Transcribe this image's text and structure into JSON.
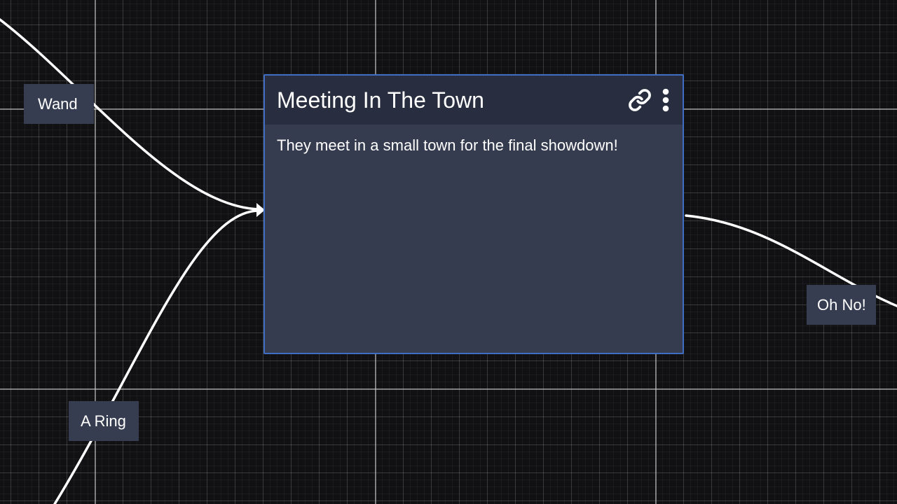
{
  "node": {
    "title": "Meeting In The Town",
    "body": "They meet in a small town for the final showdown!",
    "icons": [
      "link-icon",
      "more-vertical-icon"
    ]
  },
  "edge_labels": {
    "wand": "Wand",
    "ring": "A Ring",
    "oh_no": "Oh No!"
  },
  "colors": {
    "canvas_background": "#111113",
    "node_border": "#3f6dc4",
    "node_header": "#282e3f",
    "node_body": "#353c4f",
    "edge_label_background": "#363d51",
    "edge_stroke": "#ffffff"
  }
}
